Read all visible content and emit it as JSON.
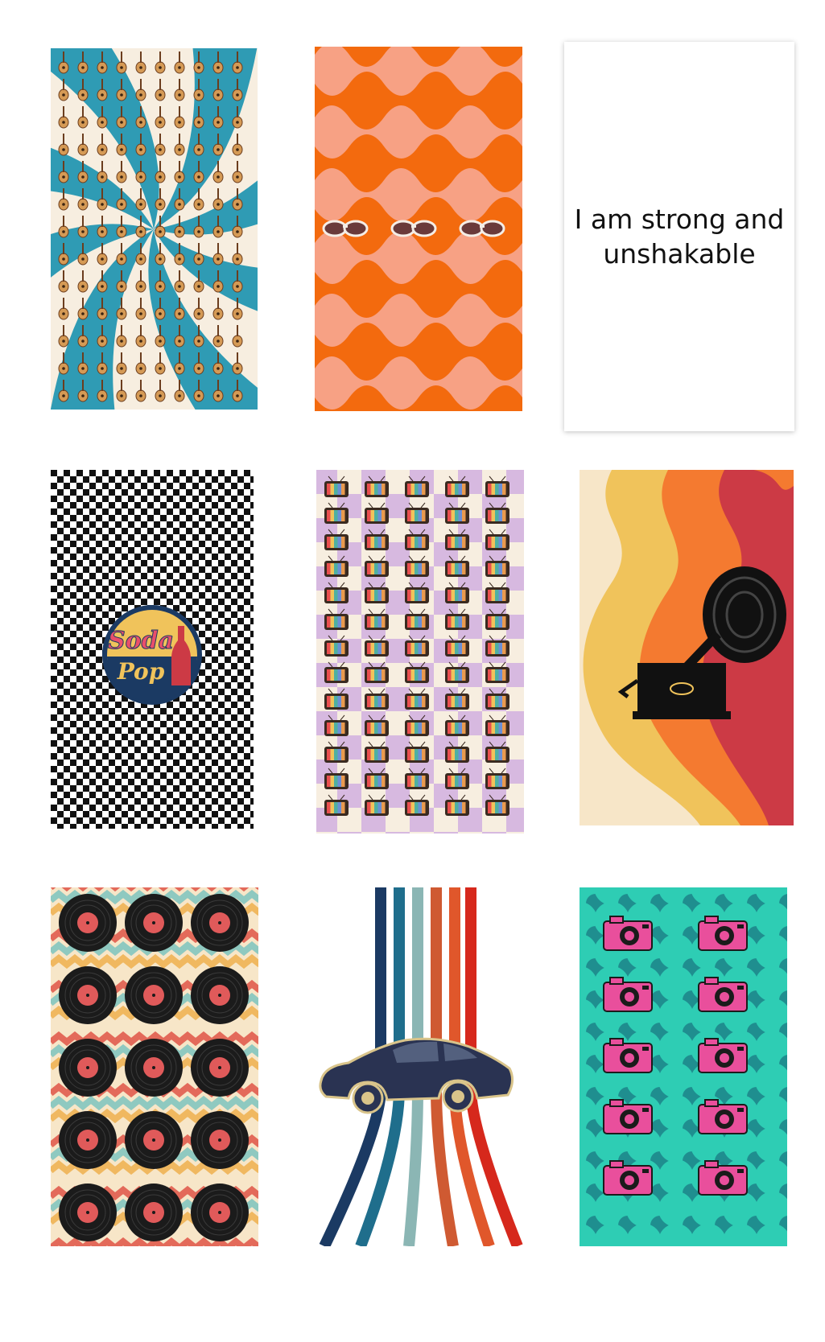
{
  "affirmation": {
    "line1": "I am strong and",
    "line2": "unshakable"
  },
  "badge": {
    "word1": "Soda",
    "word2": "Pop"
  },
  "colors": {
    "teal_blue": "#2f9bb4",
    "cream": "#f7eee0",
    "orange": "#f36a0e",
    "peach": "#f7a184",
    "lavender": "#d7b9e0",
    "mustard": "#f0c35b",
    "coral_red": "#cc3a45",
    "navy": "#1b3a63",
    "mint": "#2ecdb4",
    "hot_pink": "#e94f9c"
  },
  "tiles": [
    {
      "id": "guitars",
      "icon": "guitar-icon"
    },
    {
      "id": "sunglasses",
      "icon": "sunglasses-icon"
    },
    {
      "id": "affirmation",
      "icon": ""
    },
    {
      "id": "sodapop",
      "icon": "soda-bottle-icon"
    },
    {
      "id": "tvs",
      "icon": "retro-tv-icon"
    },
    {
      "id": "gramophone",
      "icon": "gramophone-icon"
    },
    {
      "id": "vinyls",
      "icon": "vinyl-record-icon"
    },
    {
      "id": "car",
      "icon": "vintage-car-icon"
    },
    {
      "id": "cameras",
      "icon": "camera-icon"
    }
  ]
}
